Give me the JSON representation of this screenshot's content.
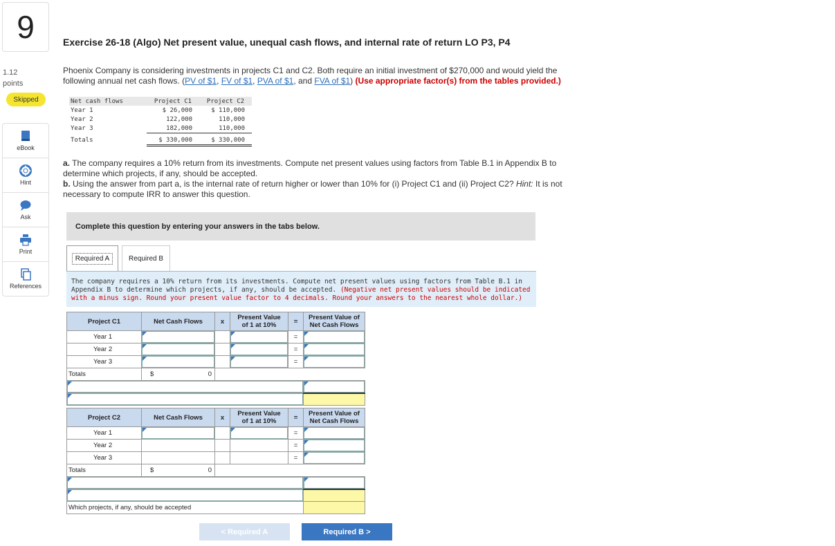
{
  "question_number": "9",
  "points_value": "1.12",
  "points_label": "points",
  "status_badge": "Skipped",
  "rail": [
    {
      "label": "eBook",
      "icon": "book-icon"
    },
    {
      "label": "Hint",
      "icon": "lifebuoy-icon"
    },
    {
      "label": "Ask",
      "icon": "chat-bubble-icon"
    },
    {
      "label": "Print",
      "icon": "printer-icon"
    },
    {
      "label": "References",
      "icon": "documents-icon"
    }
  ],
  "title": "Exercise 26-18 (Algo) Net present value, unequal cash flows, and internal rate of return LO P3, P4",
  "intro": {
    "text1": "Phoenix Company is considering investments in projects C1 and C2. Both require an initial investment of $270,000 and would yield the following annual net cash flows. (",
    "links": [
      "PV of $1",
      "FV of $1",
      "PVA of $1",
      "FVA of $1"
    ],
    "sep1": ", ",
    "sep_and": ", and ",
    "close": ") ",
    "instruction": "(Use appropriate factor(s) from the tables provided.)"
  },
  "cash_flow_table": {
    "headers": [
      "Net cash flows",
      "Project C1",
      "Project C2"
    ],
    "rows": [
      [
        "Year 1",
        "$ 26,000",
        "$ 110,000"
      ],
      [
        "Year 2",
        "122,000",
        "110,000"
      ],
      [
        "Year 3",
        "182,000",
        "110,000"
      ]
    ],
    "totals": [
      "Totals",
      "$ 330,000",
      "$ 330,000"
    ]
  },
  "parts": {
    "a_label": "a.",
    "a_text": " The company requires a 10% return from its investments. Compute net present values using factors from Table B.1 in Appendix B to determine which projects, if any, should be accepted.",
    "b_label": "b.",
    "b_text1": " Using the answer from part a, is the internal rate of return higher or lower than 10% for (i) Project C1 and (ii) Project C2? ",
    "b_hint": "Hint:",
    "b_text2": " It is not necessary to compute IRR to answer this question."
  },
  "banner": "Complete this question by entering your answers in the tabs below.",
  "tabs": [
    "Required A",
    "Required B"
  ],
  "instructions": {
    "main": "The company requires a 10% return from its investments. Compute net present values using factors from Table B.1 in Appendix B to determine which projects, if any, should be accepted. ",
    "red": "(Negative net present values should be indicated with a minus sign. Round your present value factor to 4 decimals. Round your answers to the nearest whole dollar.)"
  },
  "worksheet": {
    "c1": {
      "project": "Project C1",
      "col_ncf": "Net Cash Flows",
      "times": "x",
      "col_pv1": "Present Value",
      "col_pv2": "of 1 at 10%",
      "equals": "=",
      "col_pvn1": "Present Value of",
      "col_pvn2": "Net Cash Flows",
      "years": [
        "Year 1",
        "Year 2",
        "Year 3"
      ],
      "totals": "Totals",
      "dollar": "$",
      "total_value": "0"
    },
    "c2": {
      "project": "Project C2",
      "col_ncf": "Net Cash Flows",
      "times": "x",
      "col_pv1": "Present Value",
      "col_pv2": "of 1 at 10%",
      "equals": "=",
      "col_pvn1": "Present Value of",
      "col_pvn2": "Net Cash Flows",
      "years": [
        "Year 1",
        "Year 2",
        "Year 3"
      ],
      "totals": "Totals",
      "dollar": "$",
      "total_value": "0"
    },
    "accepted_label": "Which projects, if any, should be accepted"
  },
  "nav": {
    "prev": "< Required A",
    "next": "Required B  >"
  }
}
